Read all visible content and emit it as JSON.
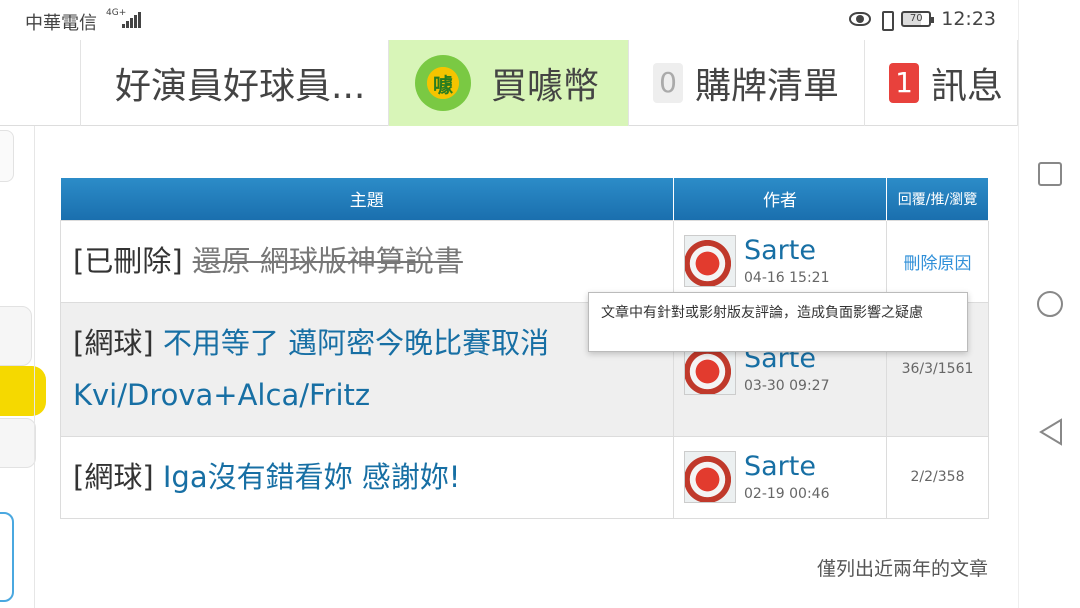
{
  "status_bar": {
    "carrier": "中華電信",
    "network": "4G+",
    "battery": "70",
    "time": "12:23"
  },
  "nav": {
    "board_tab": "好演員好球員...",
    "coin_tab": "買噱幣",
    "coin_icon_text": "噱",
    "cart_count": "0",
    "cart_tab": "購牌清單",
    "msg_count": "1",
    "msg_tab": "訊息"
  },
  "table": {
    "headers": {
      "topic": "主題",
      "author": "作者",
      "stats": "回覆/推/瀏覽"
    },
    "rows": [
      {
        "prefix": "[已刪除]",
        "title": "還原 網球版神算說書",
        "author": "Sarte",
        "date": "04-16 15:21",
        "stats": "刪除原因"
      },
      {
        "prefix": "[網球]",
        "title": "不用等了 邁阿密今晚比賽取消 Kvi/Drova+Alca/Fritz",
        "author": "Sarte",
        "date": "03-30 09:27",
        "stats": "36/3/1561"
      },
      {
        "prefix": "[網球]",
        "title": "Iga沒有錯看妳 感謝妳!",
        "author": "Sarte",
        "date": "02-19 00:46",
        "stats": "2/2/358"
      }
    ]
  },
  "tooltip": "文章中有針對或影射版友評論，造成負面影響之疑慮",
  "footer_note": "僅列出近兩年的文章",
  "colors": {
    "header_blue": "#1a6fae",
    "link_blue": "#176fa4",
    "coin_tab_bg": "#d8f5b8",
    "msg_badge_red": "#e8413c"
  }
}
